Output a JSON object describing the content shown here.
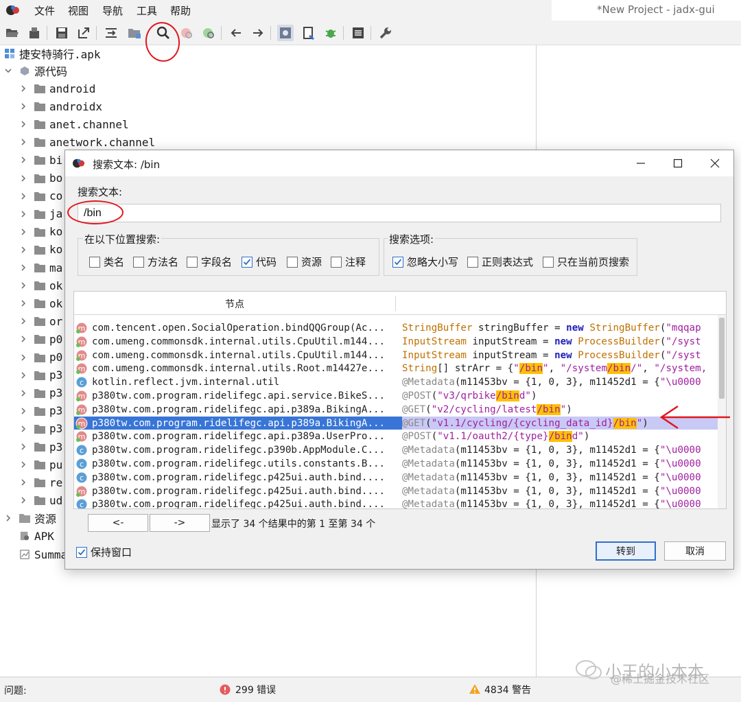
{
  "menu": [
    "文件",
    "视图",
    "导航",
    "工具",
    "帮助"
  ],
  "window_title": "*New Project - jadx-gui",
  "tree": {
    "root": "捷安特骑行.apk",
    "source_node": "源代码",
    "packages": [
      "android",
      "androidx",
      "anet.channel",
      "anetwork.channel",
      "bi",
      "bo",
      "co",
      "ja",
      "ko",
      "ko",
      "ma",
      "ok",
      "ok",
      "or",
      "p0",
      "p0",
      "p3",
      "p3",
      "p3",
      "p3",
      "p3",
      "pu",
      "re",
      "ud"
    ],
    "resources": "资源",
    "apk": "APK",
    "summary": "Summa"
  },
  "status": {
    "problems_label": "问题:",
    "errors": "299 错误",
    "warnings": "4834 警告"
  },
  "watermark": "小王的小本本",
  "watermark2": "@稀土掘金技术社区",
  "dialog": {
    "title": "搜索文本: /bin",
    "search_label": "搜索文本:",
    "search_value": "/bin",
    "search_in_label": "在以下位置搜索:",
    "search_in": [
      {
        "label": "类名",
        "checked": false
      },
      {
        "label": "方法名",
        "checked": false
      },
      {
        "label": "字段名",
        "checked": false
      },
      {
        "label": "代码",
        "checked": true
      },
      {
        "label": "资源",
        "checked": false
      },
      {
        "label": "注释",
        "checked": false
      }
    ],
    "options_label": "搜索选项:",
    "options": [
      {
        "label": "忽略大小写",
        "checked": true
      },
      {
        "label": "正则表达式",
        "checked": false
      },
      {
        "label": "只在当前页搜索",
        "checked": false
      }
    ],
    "column_node": "节点",
    "results": [
      {
        "icon": "m",
        "node": "com.tencent.open.SocialOperation.bindQQGroup(Ac...",
        "code": [
          [
            "t",
            "StringBuffer"
          ],
          [
            "n",
            " stringBuffer = "
          ],
          [
            "k",
            "new"
          ],
          [
            "n",
            " "
          ],
          [
            "t",
            "StringBuffer"
          ],
          [
            "n",
            "("
          ],
          [
            "s",
            "\"mqqap"
          ]
        ]
      },
      {
        "icon": "m",
        "node": "com.umeng.commonsdk.internal.utils.CpuUtil.m144...",
        "code": [
          [
            "t",
            "InputStream"
          ],
          [
            "n",
            " inputStream = "
          ],
          [
            "k",
            "new"
          ],
          [
            "n",
            " "
          ],
          [
            "t",
            "ProcessBuilder"
          ],
          [
            "n",
            "("
          ],
          [
            "s",
            "\"/syst"
          ]
        ]
      },
      {
        "icon": "m",
        "node": "com.umeng.commonsdk.internal.utils.CpuUtil.m144...",
        "code": [
          [
            "t",
            "InputStream"
          ],
          [
            "n",
            " inputStream = "
          ],
          [
            "k",
            "new"
          ],
          [
            "n",
            " "
          ],
          [
            "t",
            "ProcessBuilder"
          ],
          [
            "n",
            "("
          ],
          [
            "s",
            "\"/syst"
          ]
        ]
      },
      {
        "icon": "m",
        "node": "com.umeng.commonsdk.internal.utils.Root.m14427e...",
        "code": [
          [
            "t",
            "String"
          ],
          [
            "n",
            "[] strArr = {"
          ],
          [
            "s",
            "\""
          ],
          [
            "h",
            "/bin"
          ],
          [
            "s",
            "\""
          ],
          [
            "n",
            ", "
          ],
          [
            "s",
            "\"/system"
          ],
          [
            "h",
            "/bin"
          ],
          [
            "s",
            "/\""
          ],
          [
            "n",
            ", "
          ],
          [
            "s",
            "\"/system,"
          ]
        ]
      },
      {
        "icon": "c",
        "node": "kotlin.reflect.jvm.internal.util",
        "code": [
          [
            "a",
            "@Metadata"
          ],
          [
            "n",
            "(m11453bv = {1, 0, 3}, m11452d1 = {"
          ],
          [
            "s",
            "\"\\u0000"
          ]
        ]
      },
      {
        "icon": "m",
        "node": "p380tw.com.program.ridelifegc.api.service.BikeS...",
        "code": [
          [
            "a",
            "@POST"
          ],
          [
            "n",
            "("
          ],
          [
            "s",
            "\"v3/qrbike"
          ],
          [
            "h",
            "/bin"
          ],
          [
            "s",
            "d\""
          ],
          [
            "n",
            ")"
          ]
        ]
      },
      {
        "icon": "m",
        "node": "p380tw.com.program.ridelifegc.api.p389a.BikingA...",
        "code": [
          [
            "a",
            "@GET"
          ],
          [
            "n",
            "("
          ],
          [
            "s",
            "\"v2/cycling/latest"
          ],
          [
            "h",
            "/bin"
          ],
          [
            "s",
            "\""
          ],
          [
            "n",
            ")"
          ]
        ]
      },
      {
        "icon": "m",
        "node": "p380tw.com.program.ridelifegc.api.p389a.BikingA...",
        "selected": true,
        "code": [
          [
            "a",
            "@GET"
          ],
          [
            "n",
            "("
          ],
          [
            "s",
            "\"v1.1/cycling/{cycling_data_id}"
          ],
          [
            "h",
            "/bin"
          ],
          [
            "s",
            "\""
          ],
          [
            "n",
            ")"
          ]
        ]
      },
      {
        "icon": "m",
        "node": "p380tw.com.program.ridelifegc.api.p389a.UserPro...",
        "code": [
          [
            "a",
            "@POST"
          ],
          [
            "n",
            "("
          ],
          [
            "s",
            "\"v1.1/oauth2/{type}"
          ],
          [
            "h",
            "/bin"
          ],
          [
            "s",
            "d\""
          ],
          [
            "n",
            ")"
          ]
        ]
      },
      {
        "icon": "c",
        "node": "p380tw.com.program.ridelifegc.p390b.AppModule.C...",
        "code": [
          [
            "a",
            "@Metadata"
          ],
          [
            "n",
            "(m11453bv = {1, 0, 3}, m11452d1 = {"
          ],
          [
            "s",
            "\"\\u0000"
          ]
        ]
      },
      {
        "icon": "c",
        "node": "p380tw.com.program.ridelifegc.utils.constants.B...",
        "code": [
          [
            "a",
            "@Metadata"
          ],
          [
            "n",
            "(m11453bv = {1, 0, 3}, m11452d1 = {"
          ],
          [
            "s",
            "\"\\u0000"
          ]
        ]
      },
      {
        "icon": "c",
        "node": "p380tw.com.program.ridelifegc.p425ui.auth.bind....",
        "code": [
          [
            "a",
            "@Metadata"
          ],
          [
            "n",
            "(m11453bv = {1, 0, 3}, m11452d1 = {"
          ],
          [
            "s",
            "\"\\u0000"
          ]
        ]
      },
      {
        "icon": "m",
        "node": "p380tw.com.program.ridelifegc.p425ui.auth.bind....",
        "code": [
          [
            "a",
            "@Metadata"
          ],
          [
            "n",
            "(m11453bv = {1, 0, 3}, m11452d1 = {"
          ],
          [
            "s",
            "\"\\u0000"
          ]
        ]
      },
      {
        "icon": "c",
        "node": "p380tw.com.program.ridelifegc.p425ui.auth.bind....",
        "code": [
          [
            "a",
            "@Metadata"
          ],
          [
            "n",
            "(m11453bv = {1, 0, 3}, m11452d1 = {"
          ],
          [
            "s",
            "\"\\u0000"
          ]
        ]
      }
    ],
    "prev_label": "<-",
    "next_label": "->",
    "results_summary": "显示了 34 个结果中的第 1 至第 34 个",
    "keep_window_label": "保持窗口",
    "keep_window_checked": true,
    "goto_label": "转到",
    "cancel_label": "取消"
  },
  "colors": {
    "selection": "#3875d7",
    "highlight": "#ffc000",
    "annotation": "#e0161c"
  }
}
